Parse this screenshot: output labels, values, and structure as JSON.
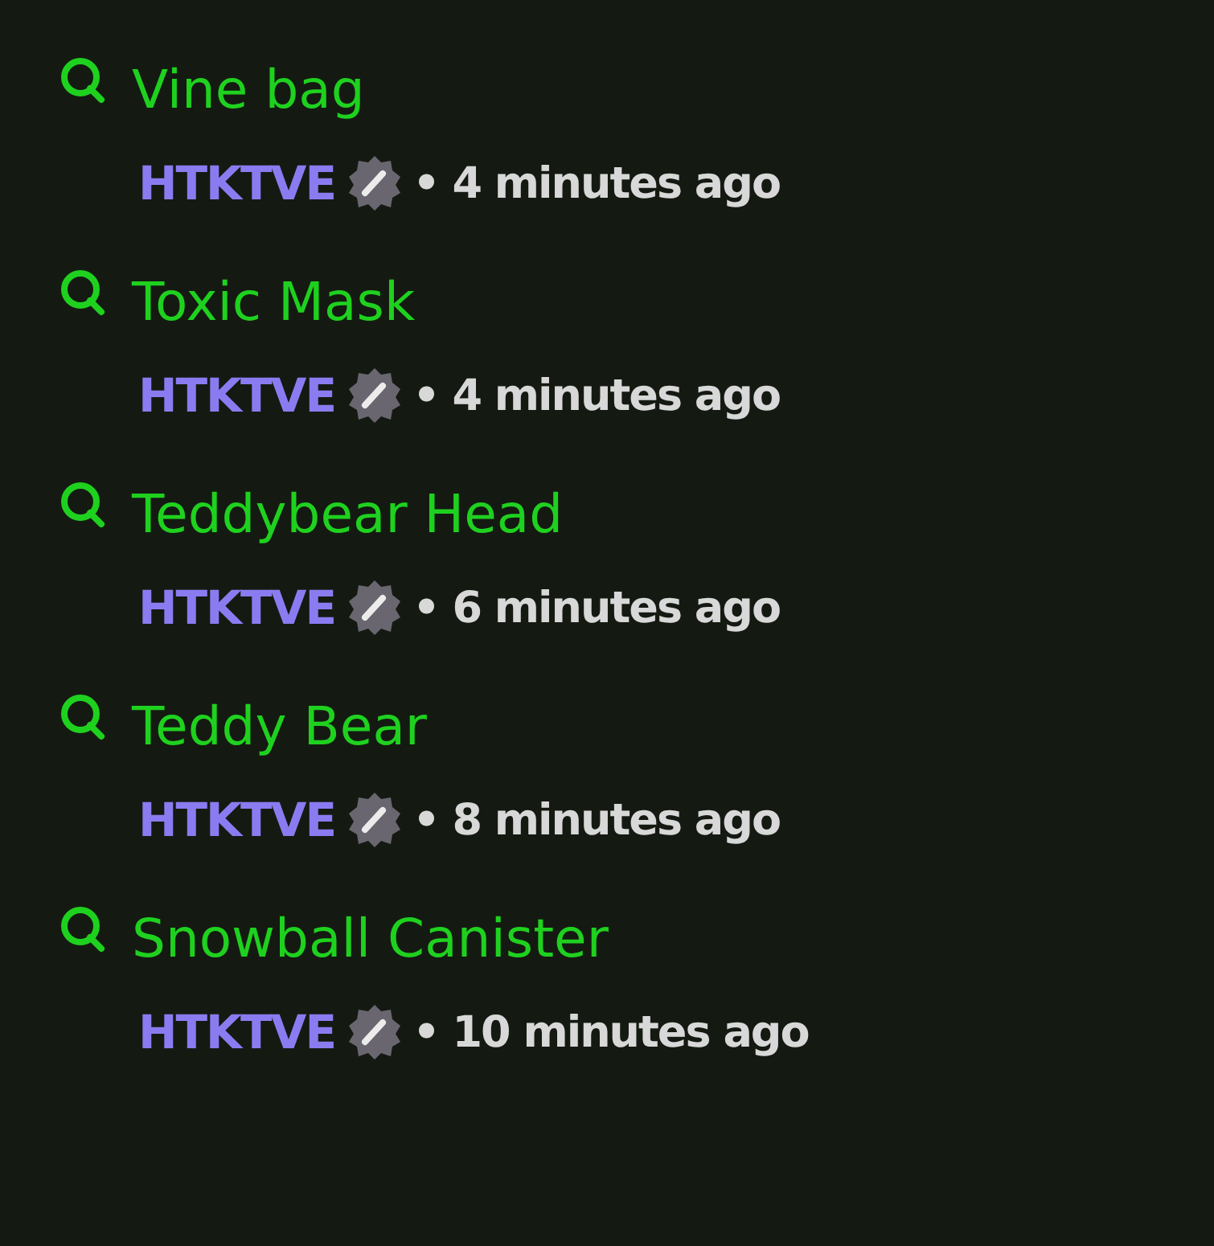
{
  "entries": [
    {
      "title": "Vine bag",
      "author": "HTKTVE",
      "time": "• 4 minutes ago"
    },
    {
      "title": "Toxic Mask",
      "author": "HTKTVE",
      "time": "• 4 minutes ago"
    },
    {
      "title": "Teddybear Head",
      "author": "HTKTVE",
      "time": "• 6 minutes ago"
    },
    {
      "title": "Teddy Bear",
      "author": "HTKTVE",
      "time": "• 8 minutes ago"
    },
    {
      "title": "Snowball Canister",
      "author": "HTKTVE",
      "time": "• 10 minutes ago"
    }
  ]
}
